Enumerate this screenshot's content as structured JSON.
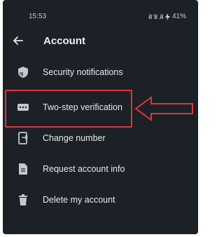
{
  "status": {
    "time": "15:53",
    "signal": "ill 'ill .ill",
    "battery": "41%"
  },
  "header": {
    "title": "Account"
  },
  "menu": {
    "items": [
      {
        "label": "Security notifications",
        "icon": "shield-icon"
      },
      {
        "label": "Two-step verification",
        "icon": "dots-keyboard-icon"
      },
      {
        "label": "Change number",
        "icon": "change-number-icon"
      },
      {
        "label": "Request account info",
        "icon": "document-icon"
      },
      {
        "label": "Delete my account",
        "icon": "trash-icon"
      }
    ]
  },
  "colors": {
    "background": "#1b2127",
    "text": "#e8eaec",
    "icon": "#c4c9cd",
    "highlight": "#e03535"
  }
}
